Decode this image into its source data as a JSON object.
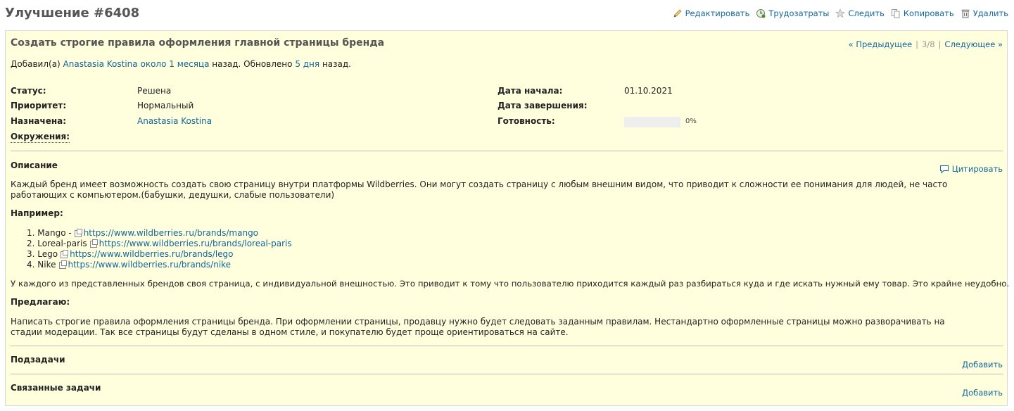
{
  "header": {
    "title": "Улучшение #6408",
    "actions": [
      {
        "name": "edit",
        "label": "Редактировать",
        "icon": "pencil-icon"
      },
      {
        "name": "log-time",
        "label": "Трудозатраты",
        "icon": "time-icon"
      },
      {
        "name": "watch",
        "label": "Следить",
        "icon": "star-icon"
      },
      {
        "name": "copy",
        "label": "Копировать",
        "icon": "copy-icon"
      },
      {
        "name": "delete",
        "label": "Удалить",
        "icon": "trash-icon"
      }
    ]
  },
  "issue": {
    "subject": "Создать строгие правила оформления главной страницы бренда",
    "nav": {
      "prev": "« Предыдущее",
      "position": "3/8",
      "next": "Следующее »",
      "sep": "|"
    },
    "author_line": {
      "prefix": "Добавил(а) ",
      "author": "Anastasia Kostina",
      "created": "около 1 месяца",
      "middle": " назад. Обновлено ",
      "updated": "5 дня",
      "suffix": " назад."
    },
    "attributes": {
      "status_label": "Статус:",
      "status": "Решена",
      "priority_label": "Приоритет:",
      "priority": "Нормальный",
      "assignee_label": "Назначена:",
      "assignee": "Anastasia Kostina",
      "environment_label": "Окружения:",
      "start_label": "Дата начала:",
      "start": "01.10.2021",
      "due_label": "Дата завершения:",
      "done_label": "Готовность:",
      "done": "0%",
      "done_fraction": 0
    },
    "description": {
      "heading": "Описание",
      "quote": "Цитировать",
      "p1": "Каждый бренд имеет возможность создать свою страницу внутри платформы Wildberries. Они могут создать страницу с любым внешним видом, что приводит к сложности ее понимания для людей, не часто работающих с компьютером.(бабушки, дедушки, слабые пользователи)",
      "example_head": "Например:",
      "examples": [
        {
          "n": "1.",
          "name": "Mango -",
          "url": "https://www.wildberries.ru/brands/mango"
        },
        {
          "n": "2.",
          "name": "Loreal-paris",
          "url": "https://www.wildberries.ru/brands/loreal-paris"
        },
        {
          "n": "3.",
          "name": "Lego",
          "url": "https://www.wildberries.ru/brands/lego"
        },
        {
          "n": "4.",
          "name": "Nike",
          "url": "https://www.wildberries.ru/brands/nike"
        }
      ],
      "p2": "У каждого из представленных брендов своя страница, с индивидуальной внешностью. Это приводит к тому что пользователю приходится каждый раз разбираться куда и где искать нужный ему товар. Это крайне неудобно.",
      "proposal_head": "Предлагаю:",
      "p3": "Написать строгие правила оформления страницы бренда. При оформлении страницы, продавцу нужно будет следовать заданным правилам. Нестандартно оформленные страницы можно разворачивать на стадии модерации. Так все страницы будут сделаны в одном стиле, и покупателю будет проще ориентироваться на сайте."
    },
    "subtasks": {
      "title": "Подзадачи",
      "add": "Добавить"
    },
    "relations": {
      "title": "Связанные задачи",
      "add": "Добавить"
    }
  },
  "colors": {
    "background": "#ffffdd",
    "link": "#116699",
    "border": "#d7d7d7"
  }
}
